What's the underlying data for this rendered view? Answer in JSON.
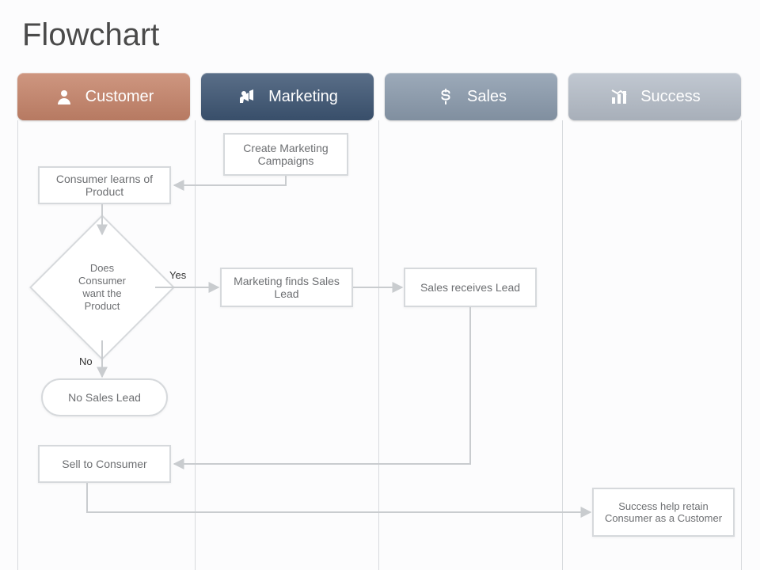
{
  "title": "Flowchart",
  "lanes": {
    "customer": {
      "label": "Customer",
      "icon": "user-icon"
    },
    "marketing": {
      "label": "Marketing",
      "icon": "megaphone-icon"
    },
    "sales": {
      "label": "Sales",
      "icon": "dollar-icon"
    },
    "success": {
      "label": "Success",
      "icon": "chart-icon"
    }
  },
  "nodes": {
    "create_campaigns": "Create Marketing Campaigns",
    "learns_product": "Consumer learns of Product",
    "decision": "Does Consumer want the Product",
    "decision_yes": "Yes",
    "decision_no": "No",
    "finds_lead": "Marketing finds Sales Lead",
    "receives_lead": "Sales receives Lead",
    "no_sales_lead": "No Sales Lead",
    "sell_consumer": "Sell to Consumer",
    "retain_customer": "Success help retain Consumer as a Customer"
  },
  "colors": {
    "customer": "#c6846a",
    "marketing": "#3d5573",
    "sales": "#8b9bad",
    "success": "#b6bec9",
    "box_border": "#d6d9dc",
    "text": "#6d6f72"
  },
  "chart_data": {
    "type": "flowchart-swimlane",
    "lanes": [
      "Customer",
      "Marketing",
      "Sales",
      "Success"
    ],
    "nodes": [
      {
        "id": "create_campaigns",
        "lane": "Marketing",
        "shape": "process",
        "label": "Create Marketing Campaigns"
      },
      {
        "id": "learns_product",
        "lane": "Customer",
        "shape": "process",
        "label": "Consumer learns of Product"
      },
      {
        "id": "decision",
        "lane": "Customer",
        "shape": "decision",
        "label": "Does Consumer want the Product"
      },
      {
        "id": "finds_lead",
        "lane": "Marketing",
        "shape": "process",
        "label": "Marketing finds Sales Lead"
      },
      {
        "id": "receives_lead",
        "lane": "Sales",
        "shape": "process",
        "label": "Sales receives Lead"
      },
      {
        "id": "no_sales_lead",
        "lane": "Customer",
        "shape": "terminator",
        "label": "No Sales Lead"
      },
      {
        "id": "sell_consumer",
        "lane": "Customer",
        "shape": "process",
        "label": "Sell to Consumer"
      },
      {
        "id": "retain_customer",
        "lane": "Success",
        "shape": "process",
        "label": "Success help retain Consumer as a Customer"
      }
    ],
    "edges": [
      {
        "from": "create_campaigns",
        "to": "learns_product"
      },
      {
        "from": "learns_product",
        "to": "decision"
      },
      {
        "from": "decision",
        "to": "finds_lead",
        "label": "Yes"
      },
      {
        "from": "decision",
        "to": "no_sales_lead",
        "label": "No"
      },
      {
        "from": "finds_lead",
        "to": "receives_lead"
      },
      {
        "from": "receives_lead",
        "to": "sell_consumer"
      },
      {
        "from": "sell_consumer",
        "to": "retain_customer"
      }
    ]
  }
}
